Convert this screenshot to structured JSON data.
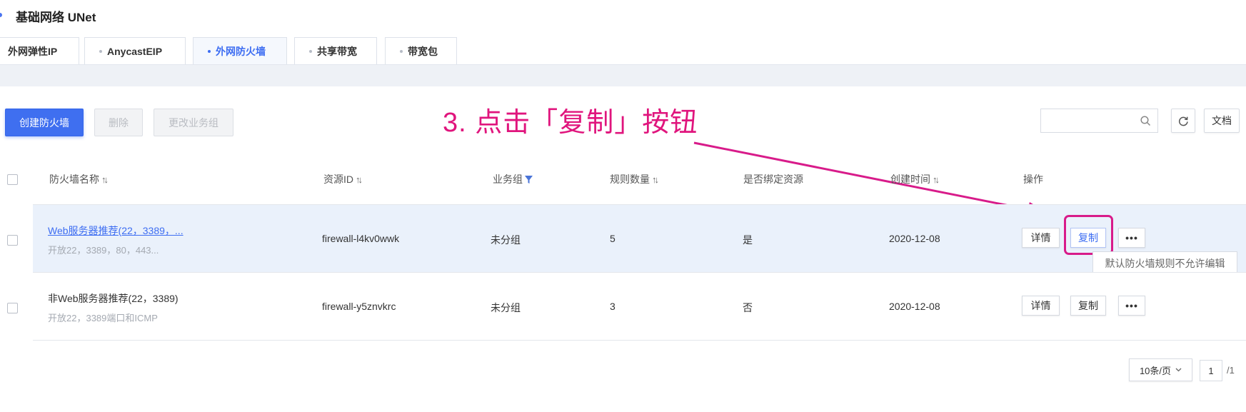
{
  "header": {
    "title": "基础网络 UNet"
  },
  "tabs": [
    {
      "label": "外网弹性IP"
    },
    {
      "label": "AnycastEIP"
    },
    {
      "label": "外网防火墙"
    },
    {
      "label": "共享带宽"
    },
    {
      "label": "带宽包"
    }
  ],
  "toolbar": {
    "create_label": "创建防火墙",
    "delete_label": "删除",
    "change_group_label": "更改业务组",
    "search_placeholder": "",
    "docs_label": "文档"
  },
  "annotation": {
    "text": "3. 点击「复制」按钮",
    "color": "#e0157d"
  },
  "table": {
    "columns": {
      "name": "防火墙名称",
      "resource_id": "资源ID",
      "group": "业务组",
      "rule_count": "规则数量",
      "bound": "是否绑定资源",
      "created": "创建时间",
      "actions": "操作"
    },
    "rows": [
      {
        "name": "Web服务器推荐(22，3389，...",
        "desc": "开放22，3389，80，443...",
        "resource_id": "firewall-l4kv0wwk",
        "group": "未分组",
        "rule_count": "5",
        "bound": "是",
        "created": "2020-12-08",
        "detail_label": "详情",
        "copy_label": "复制",
        "more_label": "•••"
      },
      {
        "name": "非Web服务器推荐(22，3389)",
        "desc": "开放22，3389端口和ICMP",
        "resource_id": "firewall-y5znvkrc",
        "group": "未分组",
        "rule_count": "3",
        "bound": "否",
        "created": "2020-12-08",
        "detail_label": "详情",
        "copy_label": "复制",
        "more_label": "•••"
      }
    ]
  },
  "tooltip": {
    "text": "默认防火墙规则不允许编辑"
  },
  "pagination": {
    "page_size": "10条/页",
    "current_page": "1",
    "total": "/1"
  },
  "colors": {
    "accent": "#3f6ff0",
    "annotation": "#d81b8a",
    "row_highlight": "#eaf1fb"
  },
  "icons": [
    "search-icon",
    "refresh-icon",
    "sort-icon",
    "filter-icon",
    "chevron-down-icon",
    "more-icon"
  ]
}
